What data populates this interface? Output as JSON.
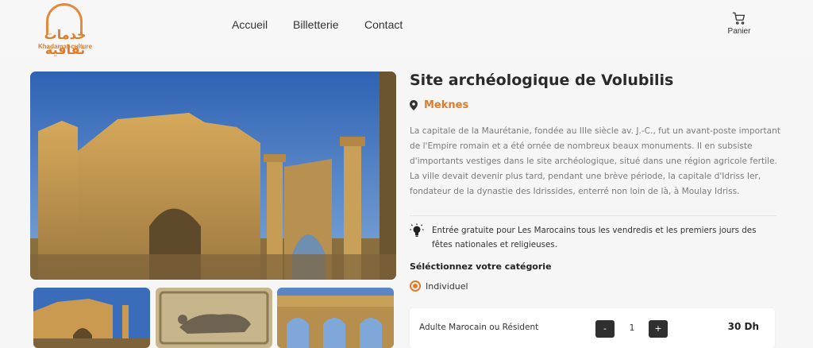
{
  "header": {
    "logo_arabic": "خدمات ثقافية",
    "logo_latin": "Khadamat-culture",
    "nav": {
      "home": "Accueil",
      "tickets": "Billetterie",
      "contact": "Contact"
    },
    "cart_label": "Panier"
  },
  "site": {
    "title": "Site archéologique de Volubilis",
    "location": "Meknes",
    "description": "La capitale de la Maurétanie, fondée au IIIe siècle av. J.-C., fut un avant-poste important de l'Empire romain et a été ornée de nombreux beaux monuments. Il en subsiste d'importants vestiges dans le site archéologique, situé dans une région agricole fertile. La ville devait devenir plus tard, pendant une brève période, la capitale d'Idriss Ier, fondateur de la dynastie des Idrissides, enterré non loin de là, à Moulay Idriss.",
    "note": "Entrée gratuite pour Les Marocains tous les vendredis et les premiers jours des fêtes nationales et religieuses."
  },
  "booking": {
    "category_label": "Séléctionnez votre catégorie",
    "category_option": "Individuel",
    "ticket": {
      "name": "Adulte Marocain ou Résident",
      "minus": "-",
      "quantity": "1",
      "plus": "+",
      "price": "30 Dh"
    }
  },
  "colors": {
    "accent": "#e07b2a",
    "button_dark": "#2f2f2f"
  },
  "icons": [
    "cart-icon",
    "location-pin-icon",
    "lightbulb-icon"
  ]
}
